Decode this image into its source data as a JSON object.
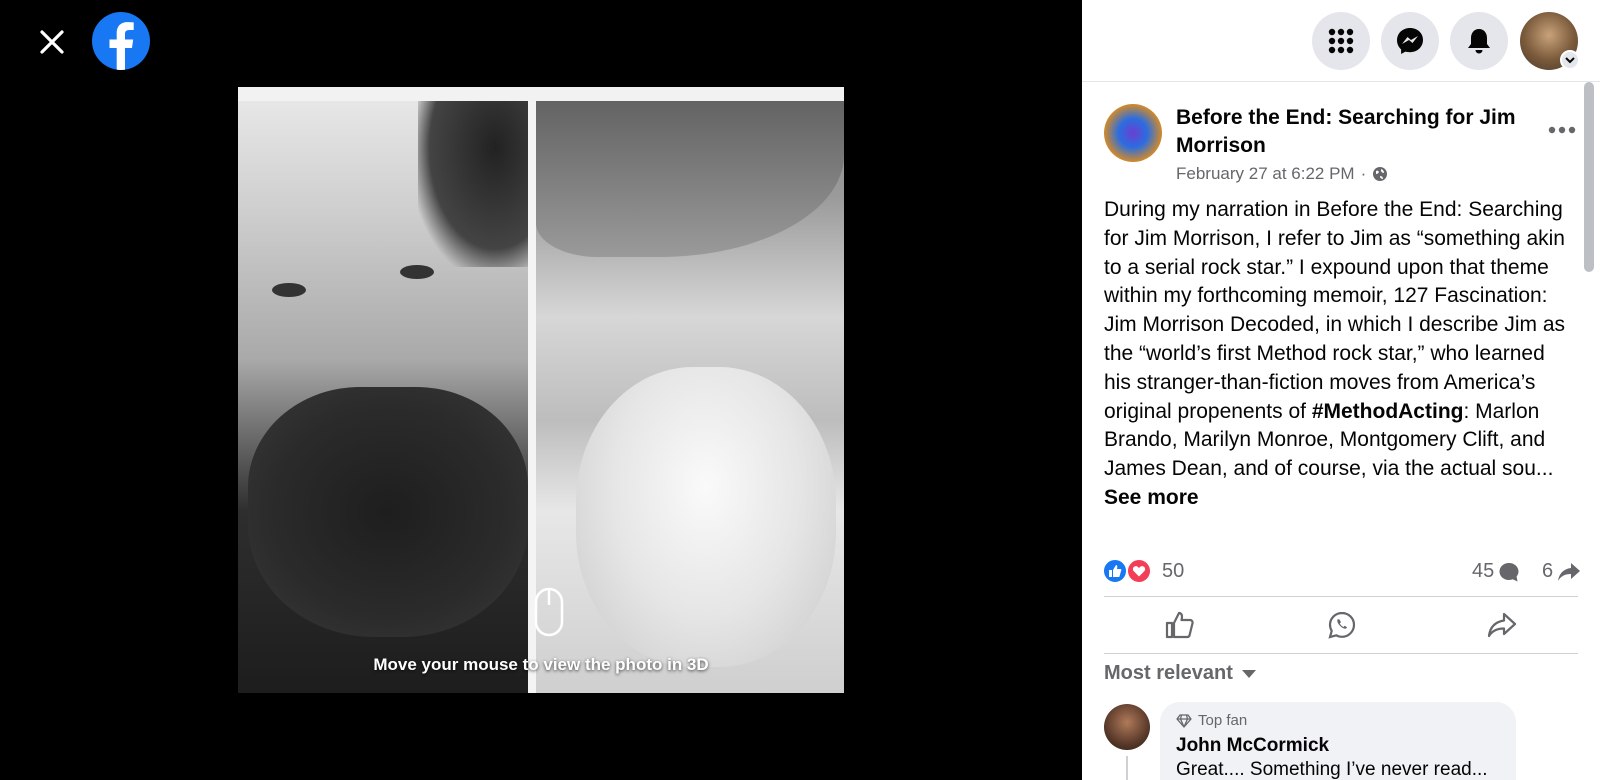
{
  "viewer": {
    "hint_text": "Move your mouse to view the photo in 3D"
  },
  "post": {
    "page_name": "Before the End: Searching for Jim Morrison",
    "timestamp": "February 27 at 6:22 PM",
    "separator": "·",
    "text_before_tag": "During my narration in Before the End: Searching for Jim Morrison, I refer to Jim as “something akin to a serial rock star.” I expound upon that theme within my forthcoming memoir, 127 Fascination: Jim Morrison Decoded, in which I describe Jim as the “world’s first Method rock star,” who learned his stranger-than-fiction moves from America’s original propenents of ",
    "hashtag": "#MethodActing",
    "text_after_tag": ": Marlon Brando, Marilyn Monroe, Montgomery Clift, and James Dean, and of course, via the actual sou... ",
    "see_more": "See more",
    "reaction_count": "50",
    "comment_count": "45",
    "share_count": "6"
  },
  "comments": {
    "sort_label": "Most relevant",
    "first": {
      "badge": "Top fan",
      "author": "John McCormick",
      "text_partial": "Great.... Something I’ve never read..."
    }
  },
  "colors": {
    "facebook_blue": "#1877f2",
    "like_blue": "#1877f2",
    "love_red": "#f33e58",
    "secondary_text": "#65676b"
  }
}
